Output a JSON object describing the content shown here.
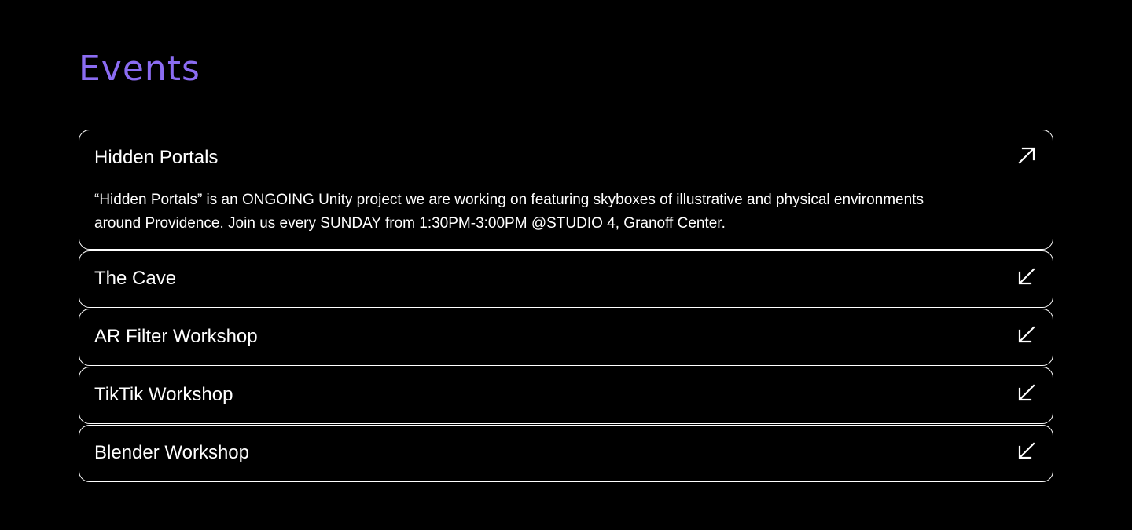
{
  "page": {
    "title": "Events"
  },
  "colors": {
    "accent": "#8B6CF2",
    "background": "#000000",
    "border": "#ffffff",
    "text": "#ffffff"
  },
  "events": [
    {
      "title": "Hidden Portals",
      "expanded": true,
      "icon": "arrow-up-right-icon",
      "description": "“Hidden Portals” is an ONGOING Unity project we are working on featuring skyboxes of illustrative and physical environments around Providence. Join us every SUNDAY from 1:30PM-3:00PM @STUDIO 4, Granoff Center."
    },
    {
      "title": "The Cave",
      "expanded": false,
      "icon": "arrow-down-left-icon"
    },
    {
      "title": "AR Filter Workshop",
      "expanded": false,
      "icon": "arrow-down-left-icon"
    },
    {
      "title": "TikTik Workshop",
      "expanded": false,
      "icon": "arrow-down-left-icon"
    },
    {
      "title": "Blender Workshop",
      "expanded": false,
      "icon": "arrow-down-left-icon"
    }
  ]
}
